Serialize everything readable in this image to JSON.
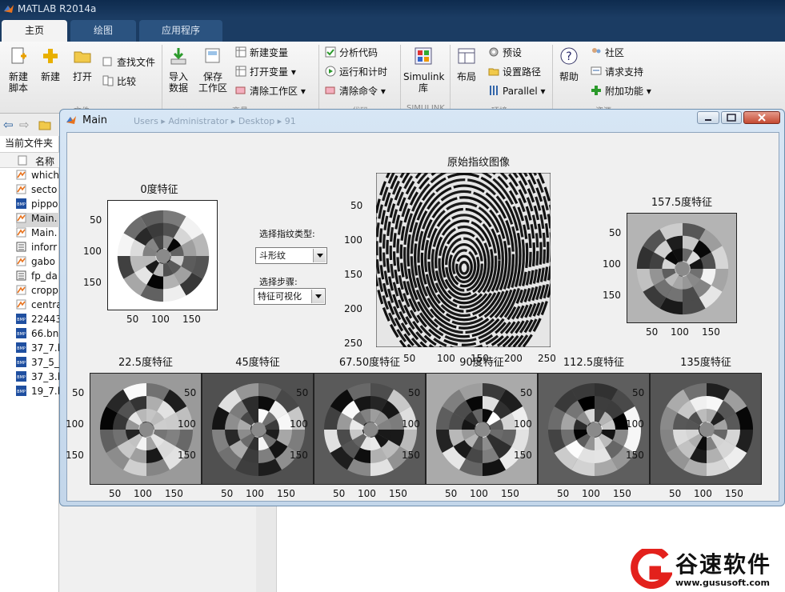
{
  "app": {
    "title": "MATLAB R2014a"
  },
  "tabs": [
    {
      "label": "主页"
    },
    {
      "label": "绘图"
    },
    {
      "label": "应用程序"
    }
  ],
  "ribbon": {
    "new_script": "新建\n脚本",
    "new": "新建",
    "open": "打开",
    "find_files": "查找文件",
    "compare": "比较",
    "import_data": "导入\n数据",
    "save_workspace": "保存\n工作区",
    "new_variable": "新建变量",
    "open_variable": "打开变量",
    "clear_workspace": "清除工作区",
    "analyze_code": "分析代码",
    "run_and_time": "运行和计时",
    "clear_commands": "清除命令",
    "simulink": "Simulink\n库",
    "layout": "布局",
    "preferences": "预设",
    "set_path": "设置路径",
    "parallel": "Parallel",
    "help": "帮助",
    "community": "社区",
    "request_support": "请求支持",
    "addons": "附加功能",
    "groups": {
      "file": "文件",
      "variable": "变量",
      "code": "代码",
      "simulink": "SIMULINK",
      "environment": "环境",
      "resources": "资源"
    }
  },
  "current_folder": {
    "header": "当前文件夹",
    "column_name": "名称",
    "files": [
      {
        "name": "which",
        "type": "m"
      },
      {
        "name": "secto",
        "type": "m"
      },
      {
        "name": "pippo",
        "type": "bmp"
      },
      {
        "name": "Main.",
        "type": "fig"
      },
      {
        "name": "Main.",
        "type": "m"
      },
      {
        "name": "inforr",
        "type": "mat"
      },
      {
        "name": "gabo",
        "type": "m"
      },
      {
        "name": "fp_da",
        "type": "mat"
      },
      {
        "name": "cropp",
        "type": "m"
      },
      {
        "name": "centra",
        "type": "m"
      },
      {
        "name": "22443",
        "type": "bmp"
      },
      {
        "name": "66.bn",
        "type": "bmp"
      },
      {
        "name": "37_7.b",
        "type": "bmp"
      },
      {
        "name": "37_5_",
        "type": "bmp"
      },
      {
        "name": "37_3.b",
        "type": "bmp"
      },
      {
        "name": "19_7.b",
        "type": "bmp"
      }
    ]
  },
  "figure": {
    "title": "Main",
    "breadcrumb": "Users ▸ Administrator ▸ Desktop ▸ 91",
    "original": {
      "title": "原始指纹图像",
      "yticks": [
        "50",
        "100",
        "150",
        "200",
        "250"
      ],
      "xticks": [
        "50",
        "100",
        "150",
        "200",
        "250"
      ]
    },
    "fingerprint_type_label": "选择指纹类型:",
    "fingerprint_type_value": "斗形纹",
    "step_label": "选择步骤:",
    "step_value": "特征可视化",
    "feature_ticks": [
      "50",
      "100",
      "150"
    ],
    "features": [
      {
        "title": "0度特征",
        "seed": 3,
        "bg": "#ffffff"
      },
      {
        "title": "157.5度特征",
        "seed": 11,
        "bg": "#b4b4b4"
      },
      {
        "title": "22.5度特征",
        "seed": 5,
        "bg": "#9a9a9a"
      },
      {
        "title": "45度特征",
        "seed": 7,
        "bg": "#505050"
      },
      {
        "title": "67.50度特征",
        "seed": 13,
        "bg": "#5a5a5a"
      },
      {
        "title": "90度特征",
        "seed": 17,
        "bg": "#aaaaaa"
      },
      {
        "title": "112.5度特征",
        "seed": 19,
        "bg": "#5e5e5e"
      },
      {
        "title": "135度特征",
        "seed": 23,
        "bg": "#555555"
      }
    ]
  },
  "watermark": {
    "name": "谷速软件",
    "url": "www.gususoft.com",
    "color": "#e3211c"
  }
}
